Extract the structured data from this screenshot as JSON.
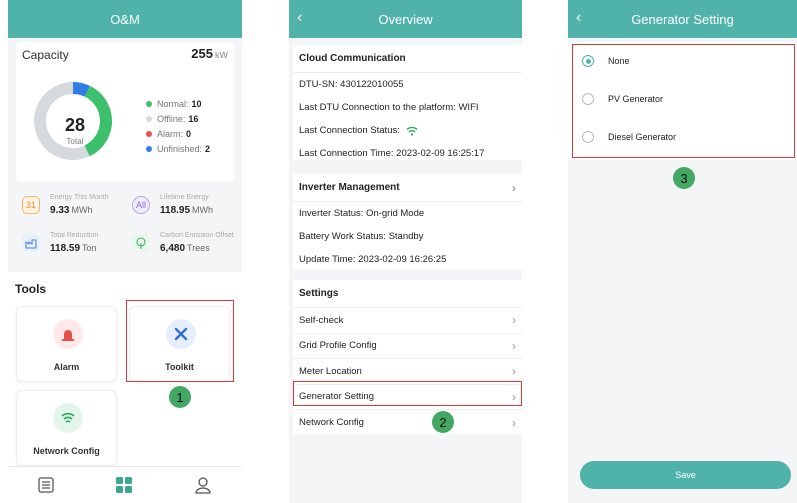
{
  "screen1": {
    "title": "O&M",
    "capacity": {
      "label": "Capacity",
      "value": "255",
      "unit": "kW"
    },
    "donut": {
      "total": "28",
      "total_label": "Total",
      "normal": 10,
      "offline": 16,
      "alarm": 0,
      "unfinished": 2
    },
    "legend": [
      {
        "label": "Normal:",
        "value": "10",
        "color": "#3cc06c"
      },
      {
        "label": "Offline:",
        "value": "16",
        "color": "#d6d9de"
      },
      {
        "label": "Alarm:",
        "value": "0",
        "color": "#e6504b"
      },
      {
        "label": "Unfinished:",
        "value": "2",
        "color": "#2f7ee6"
      }
    ],
    "stats": [
      {
        "title": "Energy This Month",
        "value": "9.33",
        "unit": "MWh",
        "icon": "calendar-icon"
      },
      {
        "title": "Lifetime Energy",
        "value": "118.95",
        "unit": "MWh",
        "icon": "all-icon"
      },
      {
        "title": "Total Reduction",
        "value": "118.59",
        "unit": "Ton",
        "icon": "factory-icon"
      },
      {
        "title": "Carbon Emission Offset",
        "value": "6,480",
        "unit": "Trees",
        "icon": "tree-icon"
      }
    ],
    "calendar_icon_text": "31",
    "all_icon_text": "All",
    "tools_title": "Tools",
    "tools": [
      {
        "label": "Alarm",
        "icon": "alarm-icon"
      },
      {
        "label": "Toolkit",
        "icon": "toolkit-icon"
      },
      {
        "label": "Network Config",
        "icon": "wifi-icon"
      }
    ],
    "step": "1"
  },
  "screen2": {
    "title": "Overview",
    "cloud": {
      "title": "Cloud Communication",
      "dtu_sn": "DTU-SN: 430122010055",
      "last_dtu": "Last DTU Connection to the platform: WIFI",
      "last_status": "Last Connection Status:",
      "last_time": "Last Connection Time: 2023-02-09 16:25:17"
    },
    "inverter": {
      "title": "Inverter Management",
      "status": "Inverter Status: On-grid Mode",
      "battery": "Battery Work Status: Standby",
      "update": "Update Time: 2023-02-09 16:26:25"
    },
    "settings": {
      "title": "Settings",
      "items": [
        "Self-check",
        "Grid Profile Config",
        "Meter Location",
        "Generator Setting",
        "Network Config"
      ]
    },
    "step": "2"
  },
  "screen3": {
    "title": "Generator Setting",
    "options": [
      "None",
      "PV Generator",
      "Diesel Generator"
    ],
    "selected": "None",
    "save_label": "Save",
    "step": "3"
  },
  "colors": {
    "accent": "#4fb3a9",
    "highlight": "#d93a3a",
    "step_badge": "#43a863"
  }
}
